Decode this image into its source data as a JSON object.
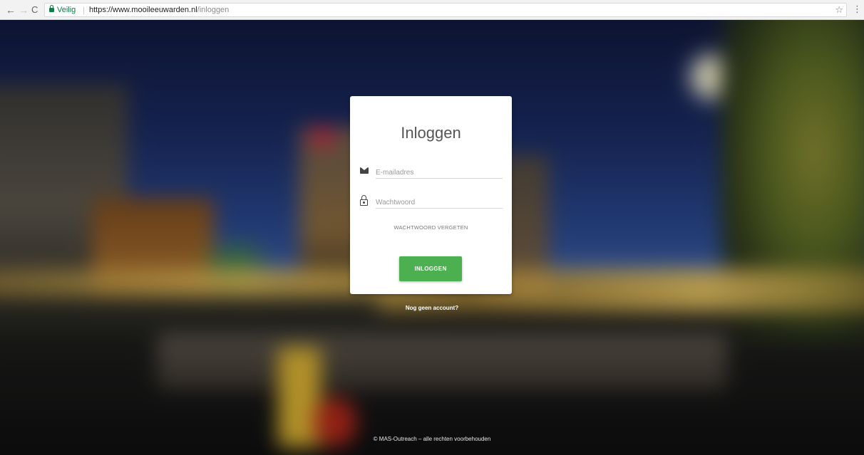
{
  "browser": {
    "security_label": "Veilig",
    "url_host": "https://www.mooileeuwarden.nl",
    "url_path": "/inloggen",
    "icons": [
      "back-arrow-icon",
      "forward-arrow-icon",
      "reload-icon",
      "lock-icon",
      "star-icon",
      "menu-icon"
    ]
  },
  "login": {
    "title": "Inloggen",
    "email_placeholder": "E-mailadres",
    "password_placeholder": "Wachtwoord",
    "forgot_label": "WACHTWOORD VERGETEN",
    "submit_label": "INLOGGEN",
    "button_color": "#4caf50",
    "icons": [
      "mail-icon",
      "lock-icon"
    ]
  },
  "signup_link": "Nog geen account?",
  "footer": "© MAS-Outreach – alle rechten voorbehouden"
}
